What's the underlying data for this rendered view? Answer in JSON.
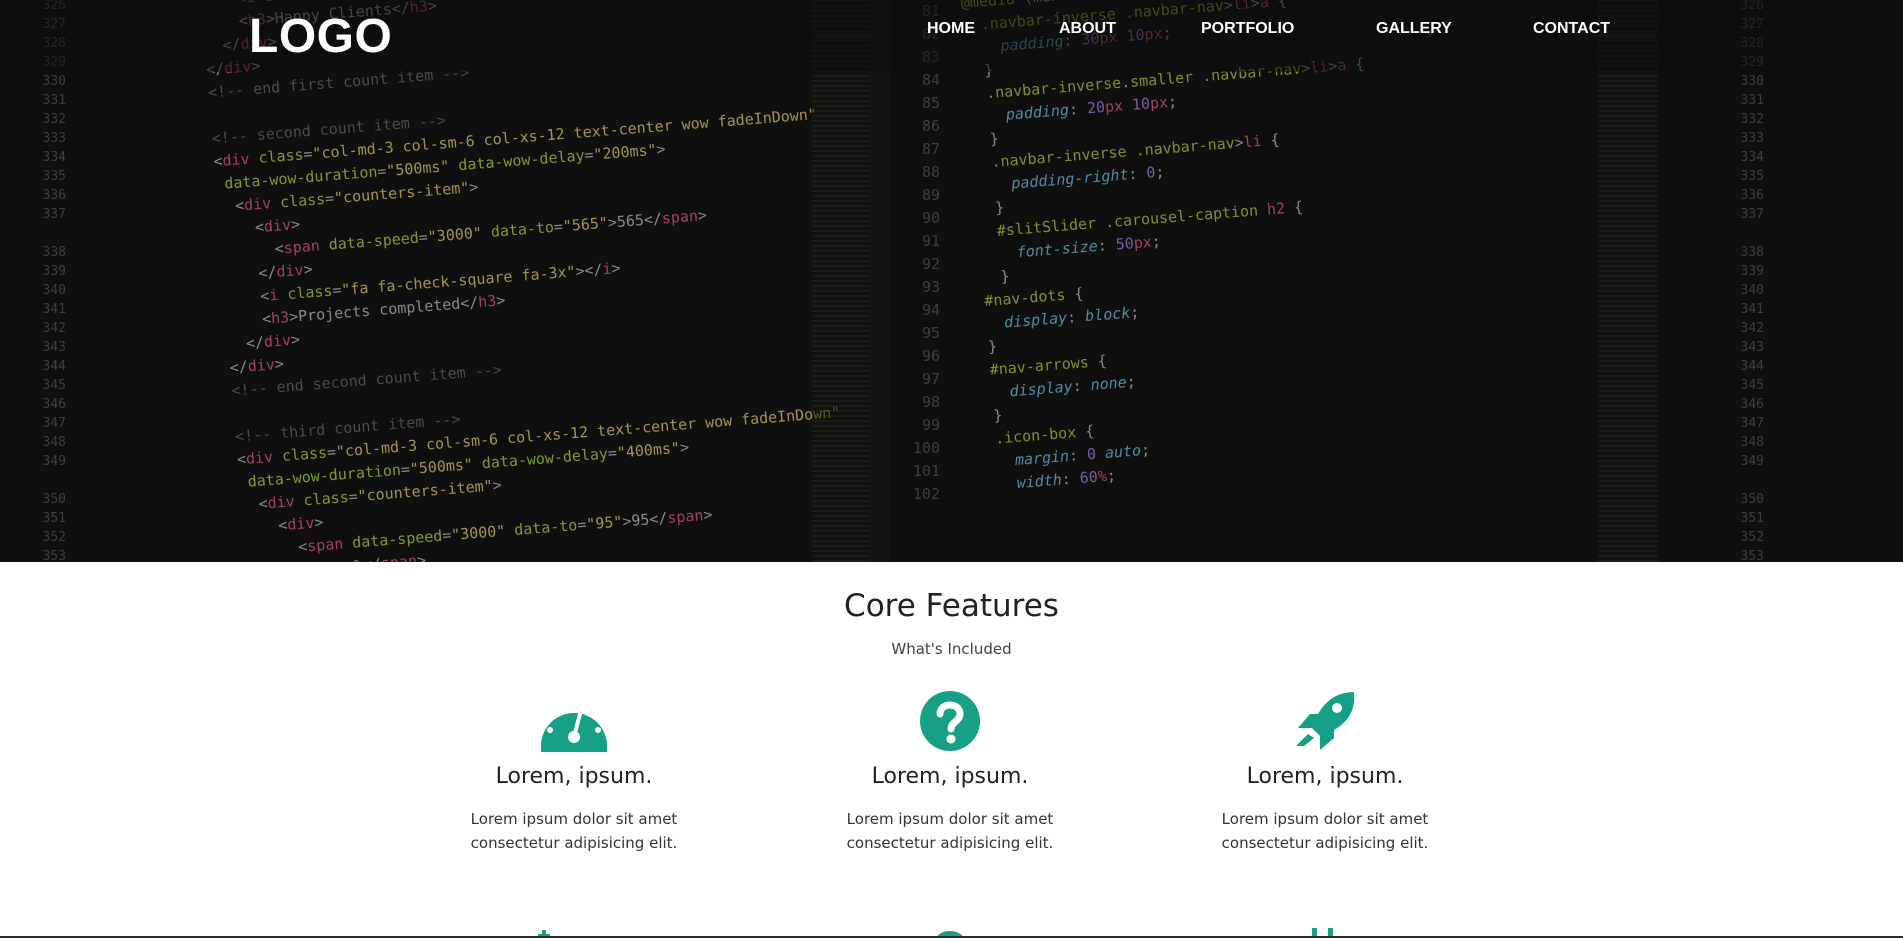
{
  "navbar": {
    "logo": "LOGO",
    "items": [
      {
        "label": "HOME"
      },
      {
        "label": "ABOUT"
      },
      {
        "label": "PORTFOLIO"
      },
      {
        "label": "GALLERY"
      },
      {
        "label": "CONTACT"
      }
    ]
  },
  "hero": {
    "gutter_left": [
      "326",
      "327",
      "328",
      "329",
      "330",
      "331",
      "332",
      "333",
      "334",
      "335",
      "336",
      "337",
      "",
      "338",
      "339",
      "340",
      "341",
      "342",
      "343",
      "344",
      "345",
      "346",
      "347",
      "348",
      "349",
      "",
      "350",
      "351",
      "352",
      "353"
    ],
    "gutter_mid": [
      "81",
      "82",
      "83",
      "84",
      "85",
      "86",
      "87",
      "88",
      "89",
      "90",
      "91",
      "92",
      "93",
      "94",
      "95",
      "96",
      "97",
      "98",
      "99",
      "100",
      "101",
      "102"
    ],
    "gutter_right": [
      "326",
      "327",
      "328",
      "329",
      "330",
      "331",
      "332",
      "333",
      "334",
      "335",
      "336",
      "337",
      "",
      "338",
      "339",
      "340",
      "341",
      "342",
      "343",
      "344",
      "345",
      "346",
      "347",
      "348",
      "349",
      "",
      "350",
      "351",
      "352",
      "353"
    ]
  },
  "features": {
    "title": "Core Features",
    "subtitle": "What's Included",
    "items": [
      {
        "icon": "dashboard-icon",
        "title": "Lorem, ipsum.",
        "text": "Lorem ipsum dolor sit amet consectetur adipisicing elit."
      },
      {
        "icon": "question-circle-icon",
        "title": "Lorem, ipsum.",
        "text": "Lorem ipsum dolor sit amet consectetur adipisicing elit."
      },
      {
        "icon": "rocket-icon",
        "title": "Lorem, ipsum.",
        "text": "Lorem ipsum dolor sit amet consectetur adipisicing elit."
      }
    ]
  },
  "colors": {
    "accent": "#16a085",
    "hero_bg": "#141414",
    "nav_text": "#ffffff"
  }
}
